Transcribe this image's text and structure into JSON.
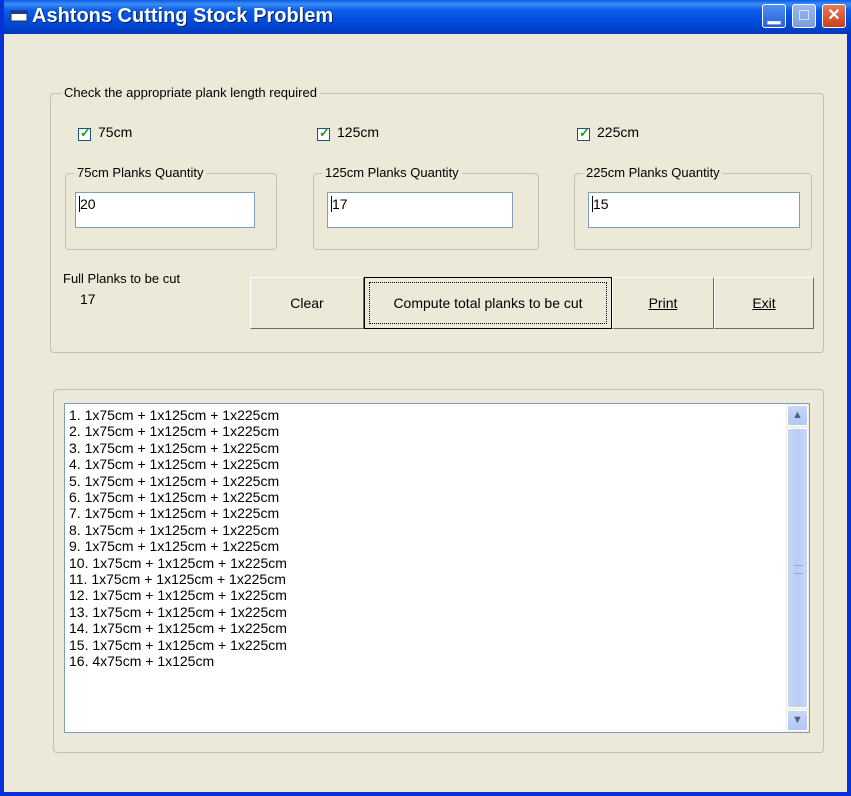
{
  "window": {
    "title": "Ashtons Cutting Stock Problem",
    "title_bar_color": "#0a5ce8"
  },
  "plank_group": {
    "legend": "Check the appropriate  plank length required",
    "checkboxes": [
      {
        "label": "75cm",
        "checked": true
      },
      {
        "label": "125cm",
        "checked": true
      },
      {
        "label": "225cm",
        "checked": true
      }
    ],
    "quantities": [
      {
        "legend": "75cm Planks Quantity",
        "value": "20"
      },
      {
        "legend": "125cm Planks Quantity",
        "value": "17"
      },
      {
        "legend": "225cm Planks Quantity",
        "value": "15"
      }
    ],
    "full_planks_label": "Full Planks to be cut",
    "full_planks_value": "17"
  },
  "buttons": {
    "clear": "Clear",
    "compute": "Compute total planks to be cut",
    "print": "Print",
    "exit": "Exit"
  },
  "results": [
    "1. 1x75cm + 1x125cm + 1x225cm",
    "2. 1x75cm + 1x125cm + 1x225cm",
    "3. 1x75cm + 1x125cm + 1x225cm",
    "4. 1x75cm + 1x125cm + 1x225cm",
    "5. 1x75cm + 1x125cm + 1x225cm",
    "6. 1x75cm + 1x125cm + 1x225cm",
    "7. 1x75cm + 1x125cm + 1x225cm",
    "8. 1x75cm + 1x125cm + 1x225cm",
    "9. 1x75cm + 1x125cm + 1x225cm",
    "10. 1x75cm + 1x125cm + 1x225cm",
    "11. 1x75cm + 1x125cm + 1x225cm",
    "12. 1x75cm + 1x125cm + 1x225cm",
    "13. 1x75cm + 1x125cm + 1x225cm",
    "14. 1x75cm + 1x125cm + 1x225cm",
    "15. 1x75cm + 1x125cm + 1x225cm",
    "16. 4x75cm + 1x125cm"
  ],
  "icons": {
    "window": "app-window-icon",
    "minimize": "minimize-icon",
    "maximize": "maximize-icon",
    "close": "close-icon",
    "scroll_up": "chevron-up-icon",
    "scroll_down": "chevron-down-icon",
    "check": "checkmark-icon"
  }
}
